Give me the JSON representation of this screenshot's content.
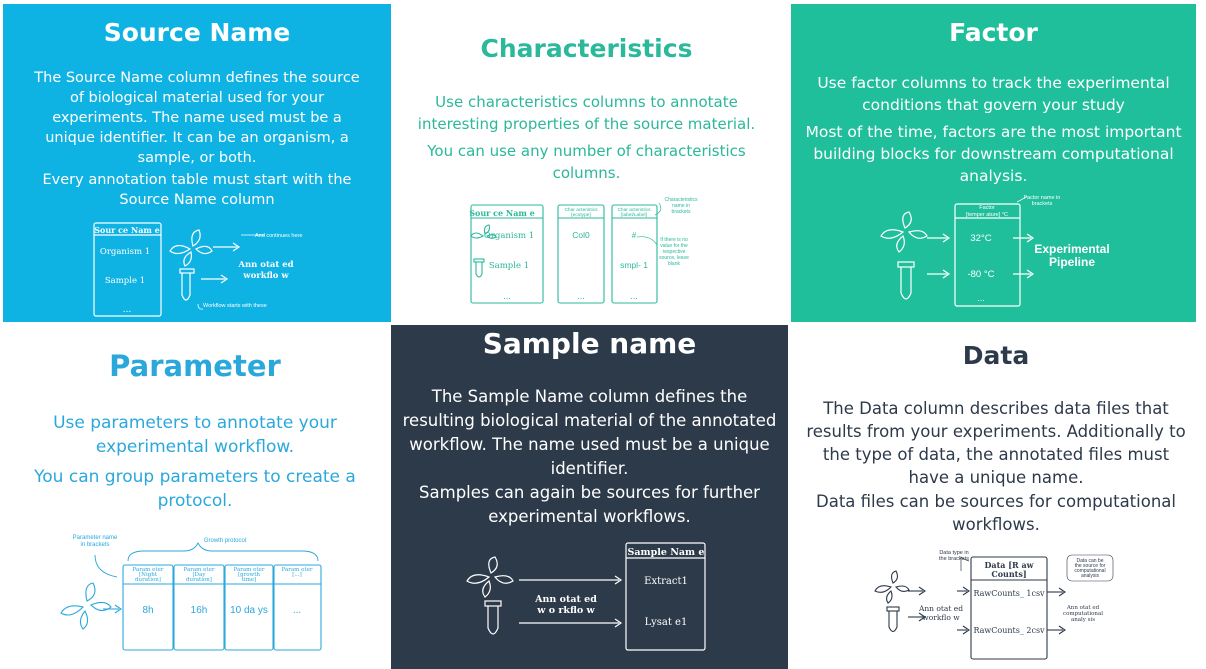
{
  "colors": {
    "source_bg": "#0fb3e3",
    "characteristics_text": "#2bb89b",
    "factor_bg": "#20bf9b",
    "parameter_text": "#2aa8dc",
    "sample_bg": "#2d3a4a",
    "data_text": "#2d3a4a"
  },
  "source": {
    "title": "Source Name",
    "para1": "The Source Name column defines the source of biological material used for your experiments. The name used must be a unique identifier. It can be an organism, a sample, or both.",
    "para2": "Every annotation table must start with the Source Name column",
    "diagram": {
      "header": "Sour ce Nam e",
      "row1": "Organism 1",
      "row2": "Sample 1",
      "ellipsis": "...",
      "continues": "And continues here",
      "annotated": "Ann otat ed",
      "workflow": "workflo w",
      "starts": "Workflow starts with these"
    }
  },
  "characteristics": {
    "title": "Characteristics",
    "para1": "Use characteristics columns to annotate interesting properties of the source material.",
    "para2": "You can use any number of characteristics columns.",
    "diagram": {
      "col1_header": "Sour ce Nam e",
      "col1_row1": "Organism 1",
      "col1_row2": "Sample 1",
      "col2_header_1": "Char acteristics",
      "col2_header_2": "[ecotype]",
      "col2_row1": "Col0",
      "col3_header_1": "Char acteristics",
      "col3_header_2": "[label/Label]",
      "col3_row1": "#",
      "col3_row2": "smpl- 1",
      "ellipsis": "...",
      "note_brackets_1": "Characteristics",
      "note_brackets_2": "name in",
      "note_brackets_3": "brackets",
      "note_blank_1": "If there is no",
      "note_blank_2": "value for the",
      "note_blank_3": "respective",
      "note_blank_4": "source, leave",
      "note_blank_5": "blank"
    }
  },
  "factor": {
    "title": "Factor",
    "para1": "Use factor columns to track the experimental conditions that govern your study",
    "para2": "Most of the time, factors are the most important building blocks for downstream computational analysis.",
    "diagram": {
      "header_1": "Factor",
      "header_2": "[temper ature] °C",
      "row1": "32°C",
      "row2": "-80 °C",
      "ellipsis": "...",
      "note_1": "Factor name in",
      "note_2": "brackets",
      "pipeline_1": "Experimental",
      "pipeline_2": "Pipeline"
    }
  },
  "parameter": {
    "title": "Parameter",
    "para1": "Use parameters to annotate your experimental workflow.",
    "para2": "You can group parameters to create a protocol.",
    "diagram": {
      "note_1": "Parameter name",
      "note_2": "in brackets",
      "group": "Growth protocol",
      "cols": [
        {
          "h1": "Param eter",
          "h2": "[Night",
          "h3": "duration]",
          "v": "8h"
        },
        {
          "h1": "Param eter",
          "h2": "[Day",
          "h3": "duration]",
          "v": "16h"
        },
        {
          "h1": "Param eter",
          "h2": "[growth",
          "h3": "time]",
          "v": "10 da ys"
        },
        {
          "h1": "Param eter",
          "h2": "[...]",
          "h3": "",
          "v": "..."
        }
      ]
    }
  },
  "sample": {
    "title": "Sample name",
    "para1": "The Sample Name column defines the resulting biological material of the annotated workflow. The name used must be a unique identifier.",
    "para2": "Samples can again be sources for further experimental workflows.",
    "diagram": {
      "header": "Sample Nam e",
      "row1": "Extract1",
      "row2": "Lysat e1",
      "annotated": "Ann otat ed",
      "workflow": "w o rkflo w"
    }
  },
  "data": {
    "title": "Data",
    "para1": "The Data column describes data files that results from your experiments. Additionally to the type of data, the annotated files must have a unique name.",
    "para2": "Data files can be sources for computational workflows.",
    "diagram": {
      "header_1": "Data [R aw",
      "header_2": "Counts]",
      "row1": "RawCounts_ 1csv",
      "row2": "RawCounts_ 2csv",
      "note_type_1": "Data type in",
      "note_type_2": "the brackets",
      "note_source_1": "Data can be",
      "note_source_2": "the source for",
      "note_source_3": "computational",
      "note_source_4": "analysis",
      "annotated": "Ann otat ed",
      "workflow": "workflo w",
      "comp_1": "Ann otat ed",
      "comp_2": "computational",
      "comp_3": "analy sis"
    }
  }
}
